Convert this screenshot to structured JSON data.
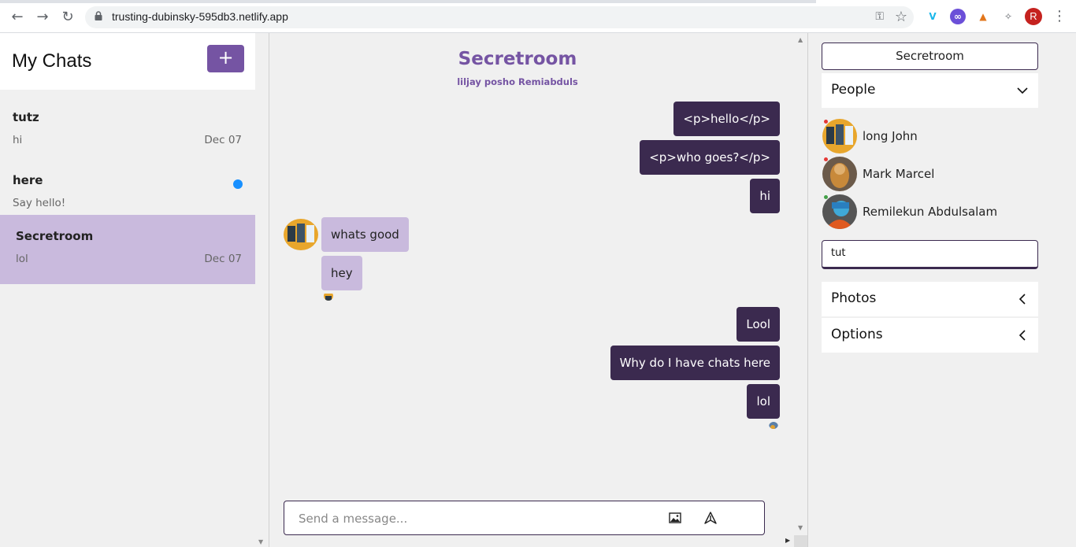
{
  "browser": {
    "url": "trusting-dubinsky-595db3.netlify.app",
    "profile_initial": "R"
  },
  "sidebar": {
    "title": "My Chats",
    "new_chat_label": "+",
    "chats": [
      {
        "name": "tutz",
        "preview": "hi",
        "date": "Dec 07",
        "unread": false
      },
      {
        "name": "here",
        "preview": "Say hello!",
        "date": "",
        "unread": true
      },
      {
        "name": "Secretroom",
        "preview": "lol",
        "date": "Dec 07",
        "unread": false,
        "active": true
      }
    ]
  },
  "chat": {
    "title": "Secretroom",
    "members": "liljay posho Remiabduls",
    "messages": [
      {
        "text": "<p>hello</p>",
        "mine": true
      },
      {
        "text": "<p>who goes?</p>",
        "mine": true
      },
      {
        "text": "hi",
        "mine": true
      },
      {
        "text": "whats good",
        "mine": false
      },
      {
        "text": "hey",
        "mine": false
      },
      {
        "text": "Lool",
        "mine": true
      },
      {
        "text": "Why do I have chats here",
        "mine": true
      },
      {
        "text": "lol",
        "mine": true
      }
    ],
    "composer_placeholder": "Send a message..."
  },
  "panel": {
    "title": "Secretroom",
    "people_label": "People",
    "people": [
      {
        "name": "long John",
        "status_color": "#e53935"
      },
      {
        "name": "Mark Marcel",
        "status_color": "#e53935"
      },
      {
        "name": "Remilekun Abdulsalam",
        "status_color": "#43a047"
      }
    ],
    "input_value": "tut",
    "photos_label": "Photos",
    "options_label": "Options"
  },
  "colors": {
    "accent": "#7554a3",
    "bubble_mine": "#3b2a4f",
    "bubble_theirs": "#c9badd",
    "unread_dot": "#1890ff"
  }
}
